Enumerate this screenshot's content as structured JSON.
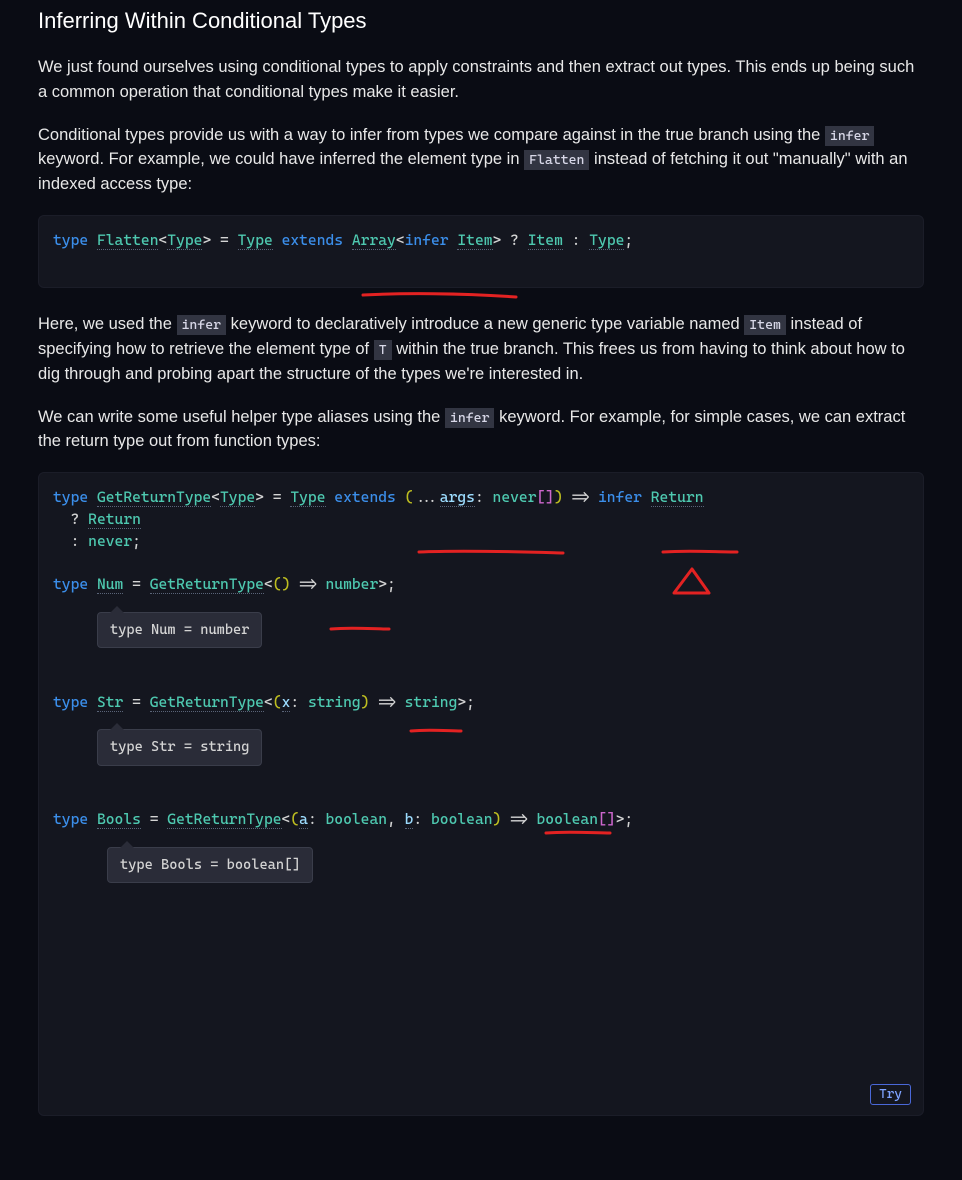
{
  "heading": "Inferring Within Conditional Types",
  "para1": "We just found ourselves using conditional types to apply constraints and then extract out types. This ends up being such a common operation that conditional types make it easier.",
  "para2_a": "Conditional types provide us with a way to infer from types we compare against in the true branch using the ",
  "para2_code1": "infer",
  "para2_b": " keyword. For example, we could have inferred the element type in ",
  "para2_code2": "Flatten",
  "para2_c": " instead of fetching it out \"manually\" with an indexed access type:",
  "code1": {
    "kw_type": "type",
    "name": "Flatten",
    "lt": "<",
    "gen1": "Type",
    "gt": ">",
    "eq": " = ",
    "typeref1": "Type",
    "sp": " ",
    "extends": "extends",
    "array": "Array",
    "lt2": "<",
    "infer": "infer",
    "item": "Item",
    "gt2": ">",
    "q": " ? ",
    "item2": "Item",
    "colon": " : ",
    "typeref2": "Type",
    "semi": ";"
  },
  "para3_a": "Here, we used the ",
  "para3_code1": "infer",
  "para3_b": " keyword to declaratively introduce a new generic type variable named ",
  "para3_code2": "Item",
  "para3_c": " instead of specifying how to retrieve the element type of ",
  "para3_code3": "T",
  "para3_d": " within the true branch. This frees us from having to think about how to dig through and probing apart the structure of the types we're interested in.",
  "para4_a": "We can write some useful helper type aliases using the ",
  "para4_code1": "infer",
  "para4_b": " keyword. For example, for simple cases, we can extract the return type out from function types:",
  "code2": {
    "l1": {
      "kw_type": "type",
      "name": "GetReturnType",
      "lt": "<",
      "gen": "Type",
      "gt": ">",
      "eq": " = ",
      "t": "Type",
      "sp": " ",
      "ext": "extends",
      "sp2": " ",
      "lp": "(",
      "dots": "...",
      "args": "args",
      "col": ": ",
      "never": "never",
      "br": "[]",
      "rp": ")",
      "arr": " => ",
      "infer": "infer",
      "sp3": " ",
      "ret": "Return"
    },
    "l2": {
      "q": "  ? ",
      "ret": "Return"
    },
    "l3": {
      "c": "  : ",
      "nev": "never",
      "semi": ";"
    },
    "blank1": "",
    "l4": {
      "kw": "type",
      "sp": " ",
      "name": "Num",
      "eq": " = ",
      "grt": "GetReturnType",
      "lt": "<",
      "lp": "(",
      "rp": ")",
      "arr": " => ",
      "num": "number",
      "gt": ">",
      "semi": ";"
    },
    "tip1": "type Num = number",
    "blank2": "",
    "l5": {
      "kw": "type",
      "sp": " ",
      "name": "Str",
      "eq": " = ",
      "grt": "GetReturnType",
      "lt": "<",
      "lp": "(",
      "x": "x",
      "col": ": ",
      "str": "string",
      "rp": ")",
      "arr": " => ",
      "str2": "string",
      "gt": ">",
      "semi": ";"
    },
    "tip2": "type Str = string",
    "blank3": "",
    "l6": {
      "kw": "type",
      "sp": " ",
      "name": "Bools",
      "eq": " = ",
      "grt": "GetReturnType",
      "lt": "<",
      "lp": "(",
      "a": "a",
      "col": ": ",
      "bool": "boolean",
      "com": ", ",
      "b": "b",
      "col2": ": ",
      "bool2": "boolean",
      "rp": ")",
      "arr": " => ",
      "bool3": "boolean",
      "br": "[]",
      "gt": ">",
      "semi": ";"
    },
    "tip3": "type Bools = boolean[]",
    "try": "Try"
  }
}
